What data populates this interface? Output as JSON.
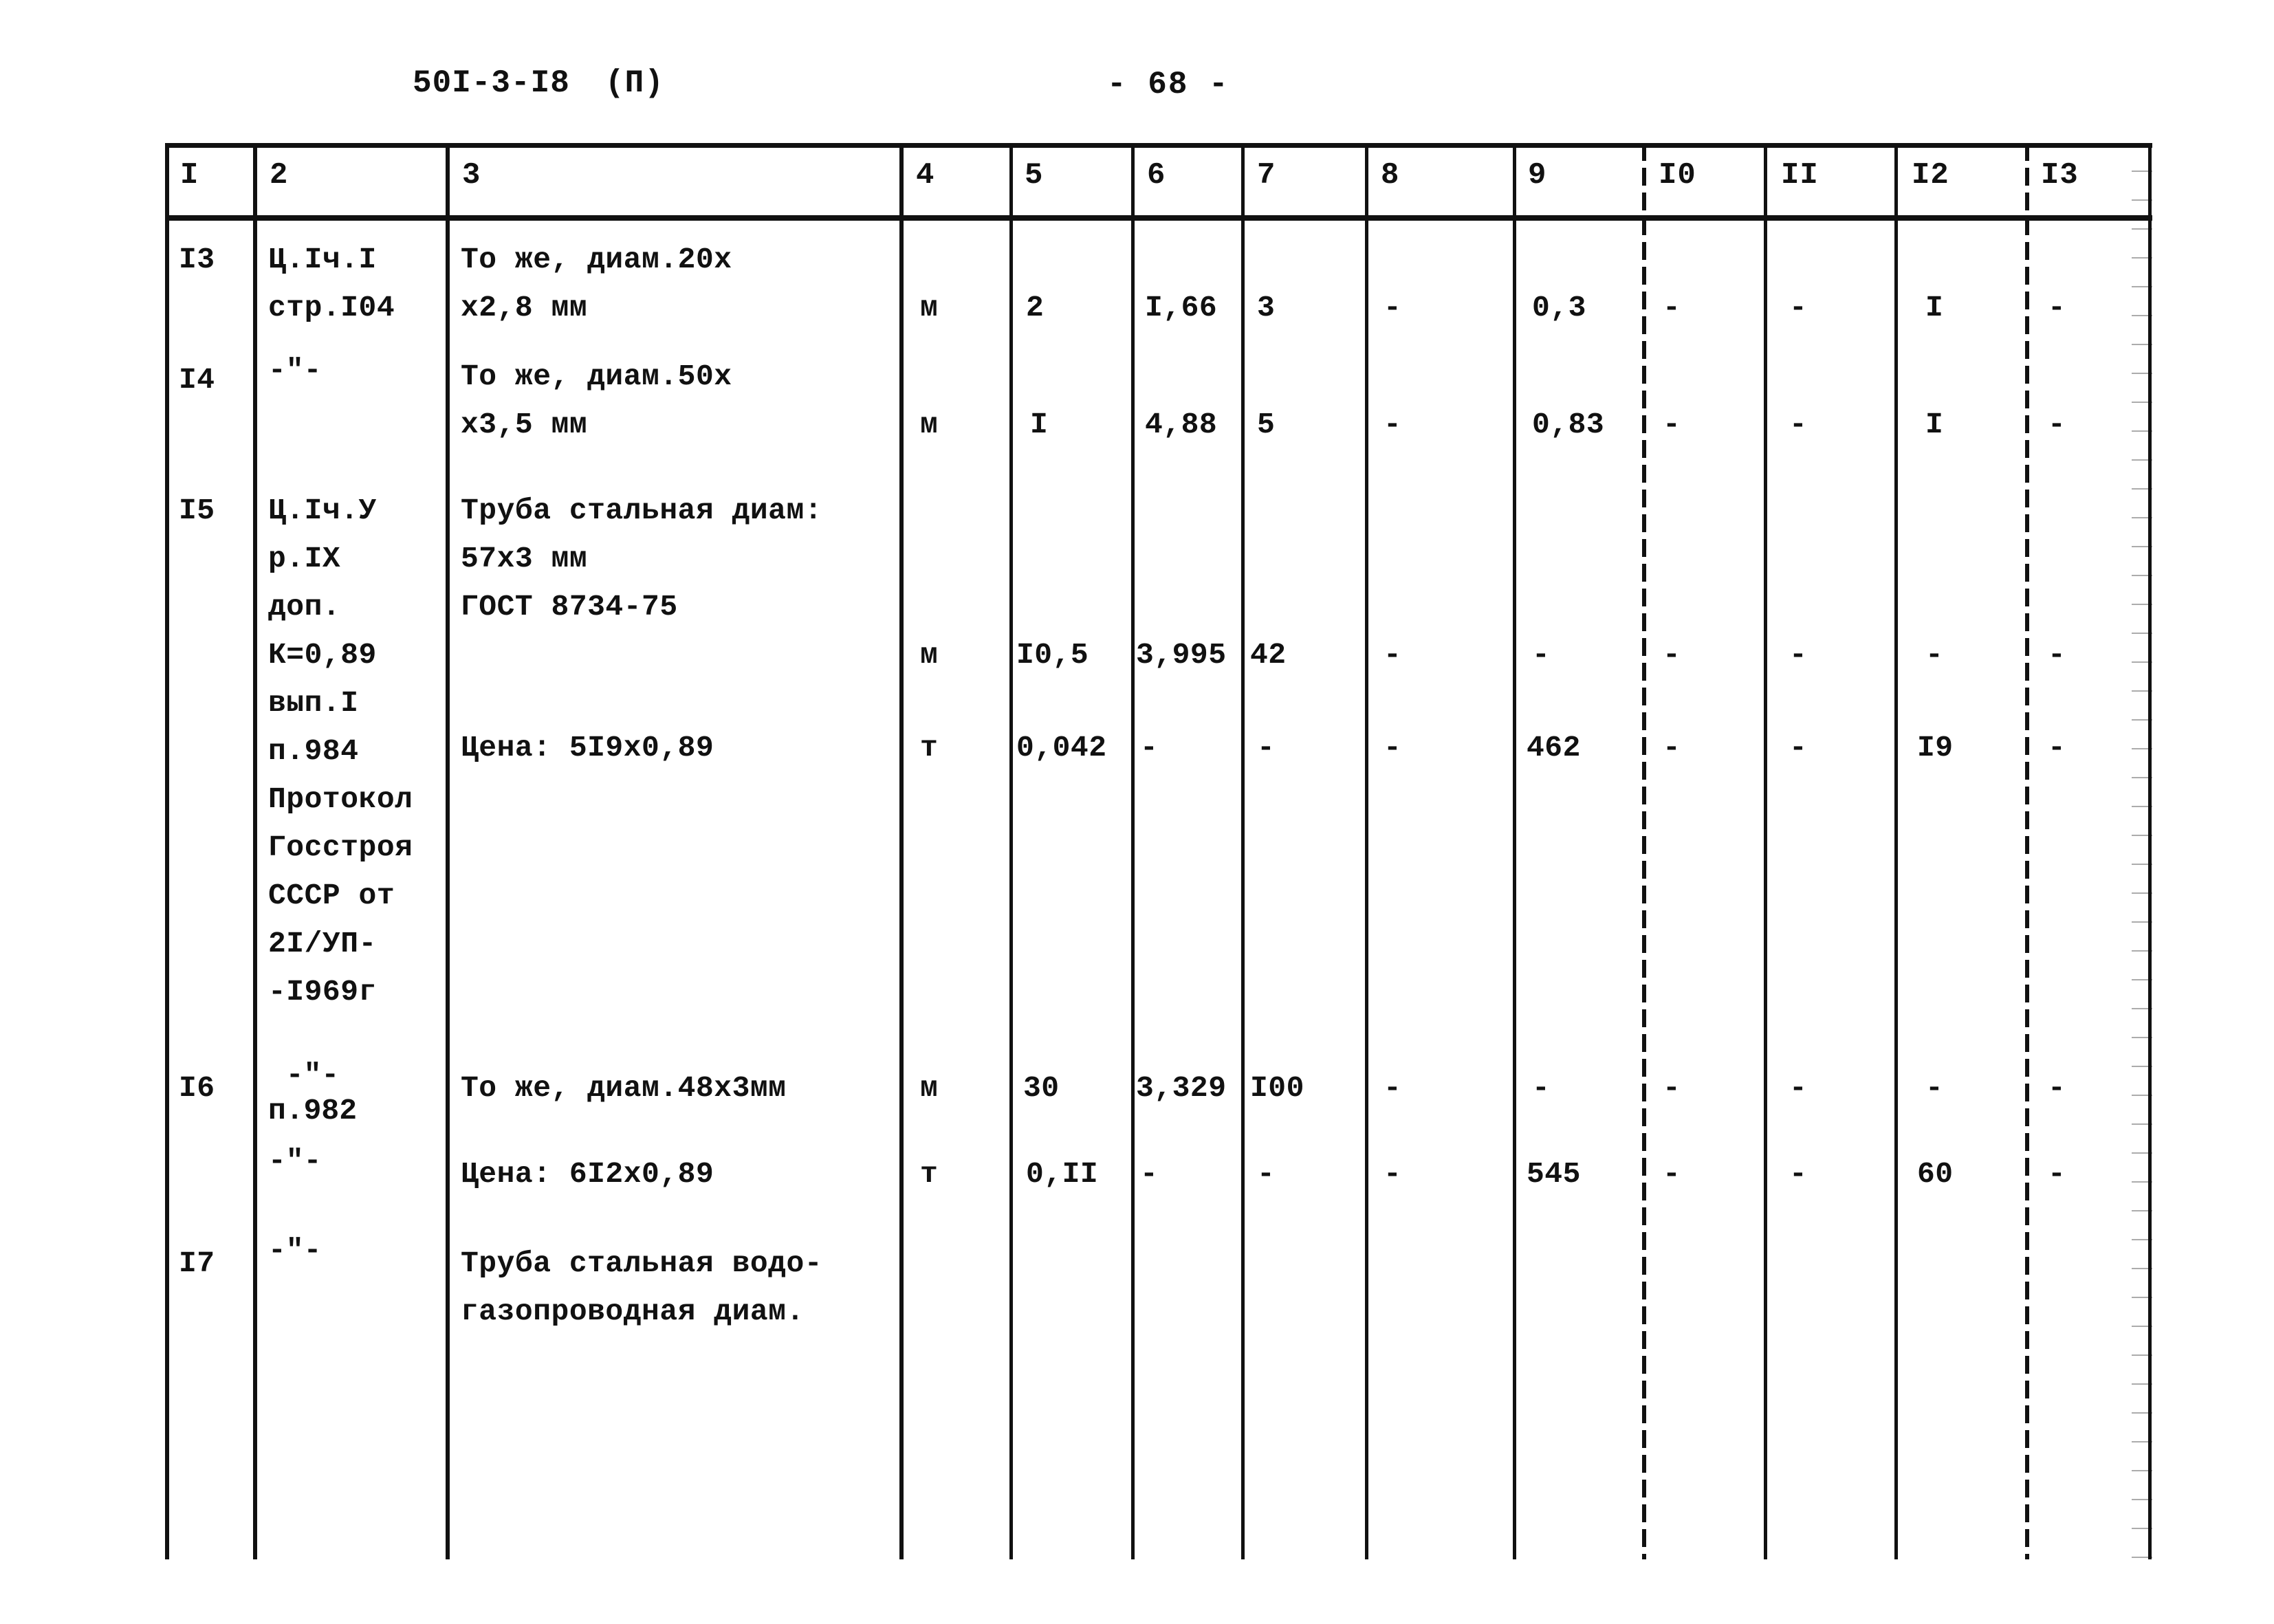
{
  "header": {
    "doc_code": "50I-3-I8",
    "doc_variant": "(П)",
    "page_number": "- 68 -"
  },
  "table": {
    "column_headers": [
      "I",
      "2",
      "3",
      "4",
      "5",
      "6",
      "7",
      "8",
      "9",
      "I0",
      "II",
      "I2",
      "I3"
    ],
    "rows": [
      {
        "num": "I3",
        "col2": "Ц.Iч.I\nстр.I04",
        "col3": "То же, диам.20х\nх2,8 мм",
        "col4": "м",
        "col5": "2",
        "col6": "I,66",
        "col7": "3",
        "col8": "-",
        "col9": "0,3",
        "col10": "-",
        "col11": "-",
        "col12": "I",
        "col13": "-"
      },
      {
        "num": "I4",
        "col2": "-\"-",
        "col3": "То же, диам.50х\nх3,5 мм",
        "col4": "м",
        "col5": "I",
        "col6": "4,88",
        "col7": "5",
        "col8": "-",
        "col9": "0,83",
        "col10": "-",
        "col11": "-",
        "col12": "I",
        "col13": "-"
      },
      {
        "num": "I5",
        "col2": "Ц.Iч.У\nр.IX\nдоп.\nК=0,89\nвып.I\nп.984\nПротокол\nГосстроя\nСССР от\n2I/УП-\n-I969г",
        "col3": "Труба стальная диам:\n57х3 мм\nГОСТ 8734-75",
        "col4": "м",
        "col5": "I0,5",
        "col6": "3,995",
        "col7": "42",
        "col8": "-",
        "col9": "-",
        "col10": "-",
        "col11": "-",
        "col12": "-",
        "col13": "-"
      },
      {
        "num": "",
        "col2": "",
        "col3": "Цена: 5I9х0,89",
        "col4": "т",
        "col5": "0,042",
        "col6": "-",
        "col7": "-",
        "col8": "-",
        "col9": "462",
        "col10": "-",
        "col11": "-",
        "col12": "I9",
        "col13": "-"
      },
      {
        "num": "I6",
        "col2": "-\"-\nп.982",
        "col3": "То же, диам.48х3мм",
        "col4": "м",
        "col5": "30",
        "col6": "3,329",
        "col7": "I00",
        "col8": "-",
        "col9": "-",
        "col10": "-",
        "col11": "-",
        "col12": "-",
        "col13": "-"
      },
      {
        "num": "",
        "col2": "-\"-",
        "col3": "Цена: 6I2х0,89",
        "col4": "т",
        "col5": "0,II",
        "col6": "-",
        "col7": "-",
        "col8": "-",
        "col9": "545",
        "col10": "-",
        "col11": "-",
        "col12": "60",
        "col13": "-"
      },
      {
        "num": "I7",
        "col2": "-\"-",
        "col3": "Труба стальная водо-\nгазопроводная диам.",
        "col4": "",
        "col5": "",
        "col6": "",
        "col7": "",
        "col8": "",
        "col9": "",
        "col10": "",
        "col11": "",
        "col12": "",
        "col13": ""
      }
    ]
  }
}
